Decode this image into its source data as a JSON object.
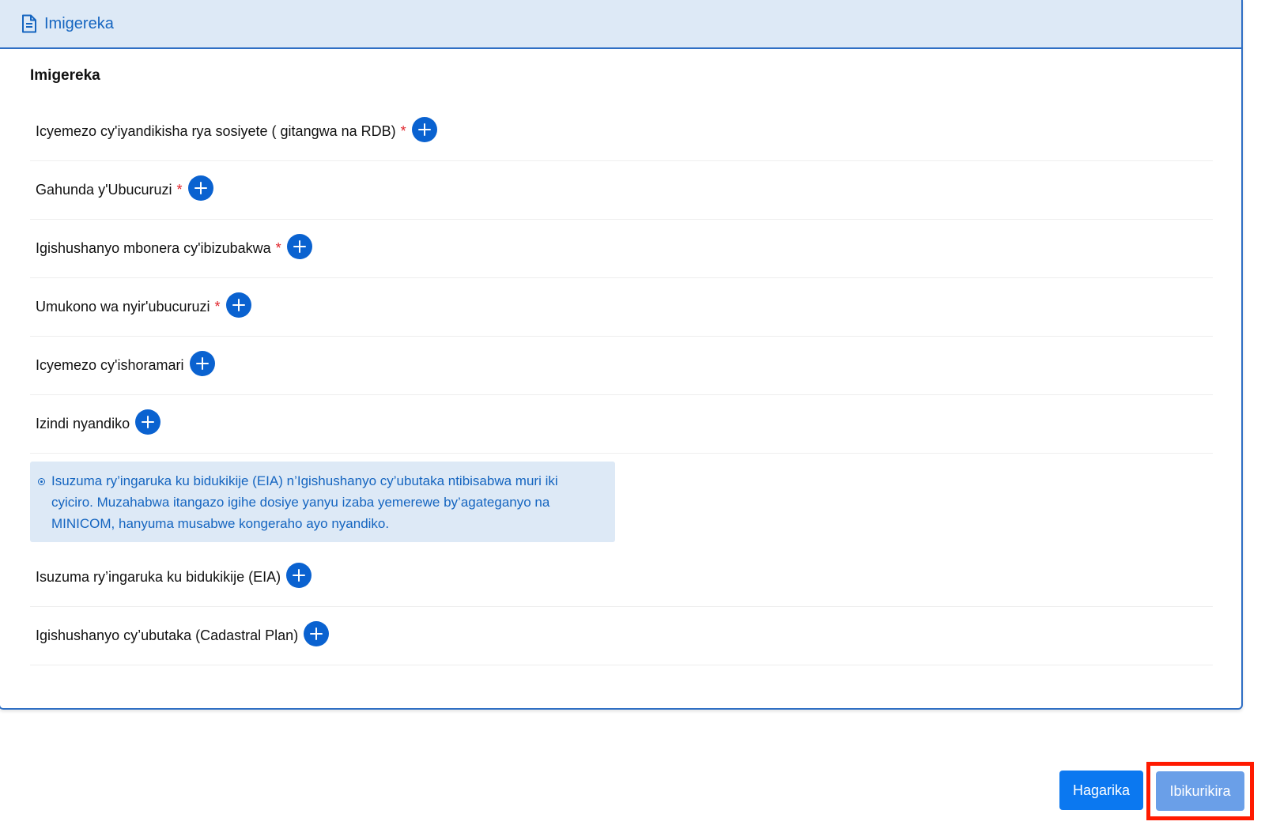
{
  "header": {
    "icon": "document-icon",
    "title": "Imigereka"
  },
  "section": {
    "title": "Imigereka"
  },
  "documents": [
    {
      "label": "Icyemezo cy'iyandikisha rya sosiyete ( gitangwa na RDB)",
      "required": "*"
    },
    {
      "label": "Gahunda y'Ubucuruzi",
      "required": "*"
    },
    {
      "label": "Igishushanyo mbonera cy'ibizubakwa",
      "required": "*"
    },
    {
      "label": "Umukono wa nyir'ubucuruzi",
      "required": "*"
    },
    {
      "label": "Icyemezo cy'ishoramari",
      "required": ""
    },
    {
      "label": "Izindi nyandiko",
      "required": ""
    },
    {
      "label": "Isuzuma ry’ingaruka ku bidukikije (EIA)",
      "required": ""
    },
    {
      "label": "Igishushanyo cy’ubutaka (Cadastral Plan)",
      "required": ""
    }
  ],
  "notice": {
    "icon": "info-icon",
    "text": "Isuzuma ry’ingaruka ku bidukikije (EIA) n’Igishushanyo cy’ubutaka ntibisabwa muri iki cyiciro. Muzahabwa itangazo igihe dosiye yanyu izaba yemerewe by’agateganyo na MINICOM, hanyuma musabwe kongeraho ayo nyandiko."
  },
  "actions": {
    "cancel_label": "Hagarika",
    "next_label": "Ibikurikira"
  },
  "colors": {
    "accent": "#0a62d0",
    "header_bg": "#dde9f6",
    "required": "#e0242b",
    "highlight": "#ff1a00"
  }
}
